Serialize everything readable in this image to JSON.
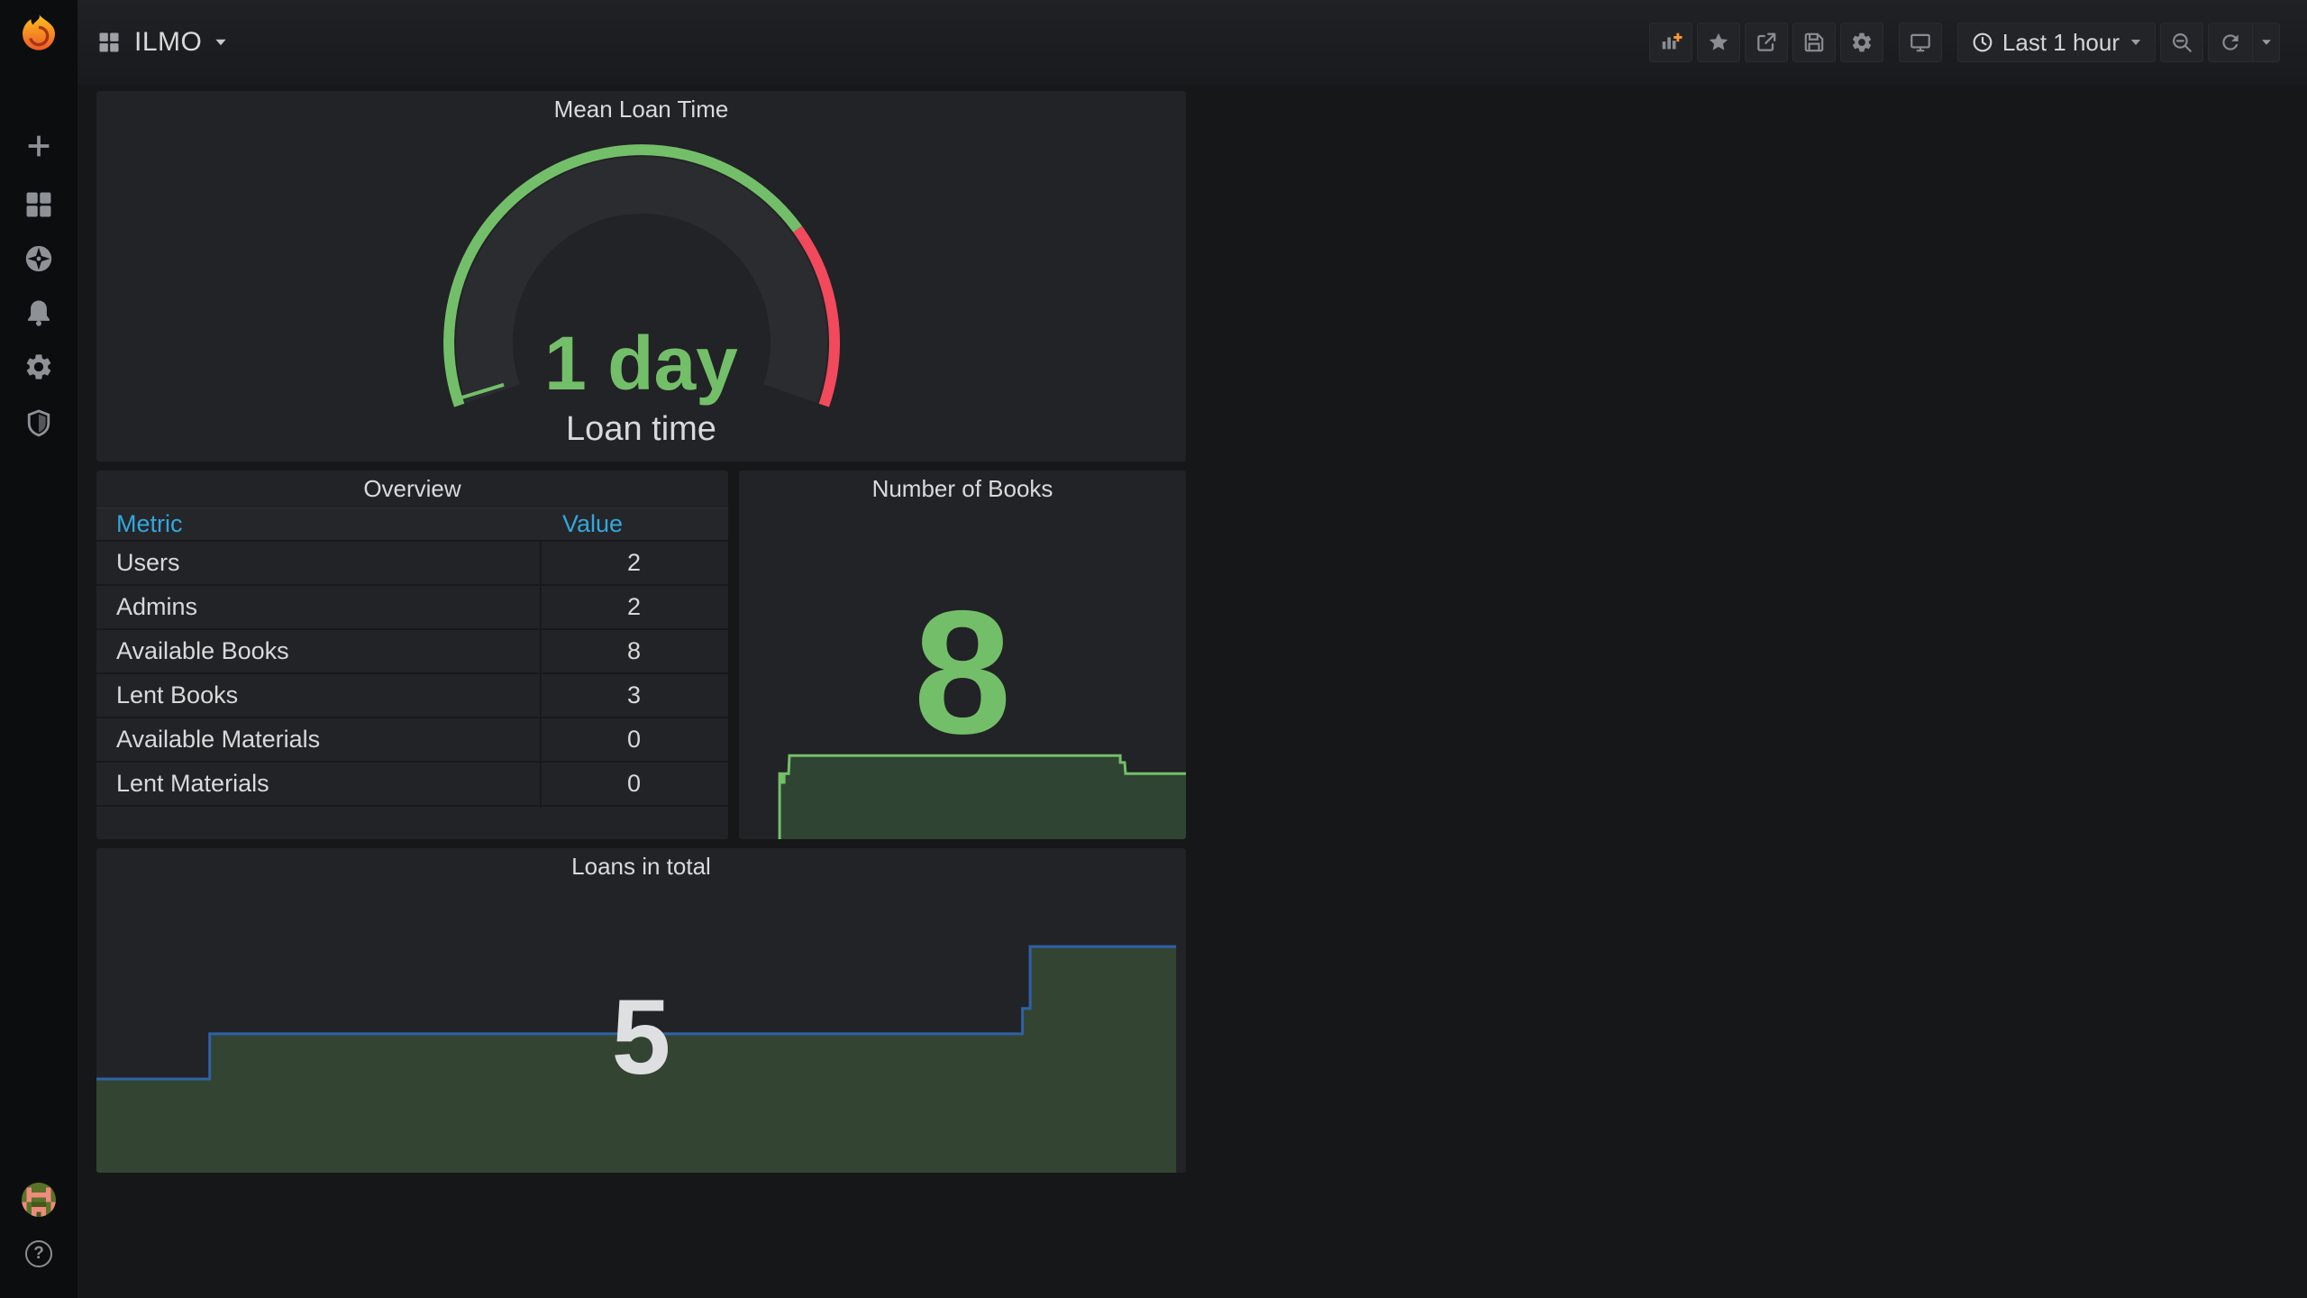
{
  "nav": {
    "dashboard_title": "ILMO",
    "time_range_label": "Last 1 hour",
    "actions": {
      "add_panel": "add-panel",
      "star": "mark-as-favorite",
      "share": "share-dashboard",
      "save": "save-dashboard",
      "settings": "dashboard-settings",
      "tv_mode": "cycle-view-mode",
      "zoom_out": "zoom-out-time-range",
      "refresh": "refresh-dashboard"
    }
  },
  "sidebar": {
    "items": [
      {
        "label": "Create",
        "icon": "plus-icon"
      },
      {
        "label": "Dashboards",
        "icon": "grid-icon"
      },
      {
        "label": "Explore",
        "icon": "compass-icon"
      },
      {
        "label": "Alerting",
        "icon": "bell-icon"
      },
      {
        "label": "Configuration",
        "icon": "gear-icon"
      },
      {
        "label": "Server Admin",
        "icon": "shield-icon"
      }
    ],
    "help_label": "?"
  },
  "panels": {
    "gauge": {
      "title": "Mean Loan Time",
      "value": "1 day",
      "label": "Loan time",
      "value_color": "#73bf69",
      "ring_green": "#73bf69",
      "ring_red": "#f2495c"
    },
    "overview": {
      "title": "Overview",
      "columns": [
        "Metric",
        "Value"
      ],
      "rows": [
        [
          "Users",
          "2"
        ],
        [
          "Admins",
          "2"
        ],
        [
          "Available Books",
          "8"
        ],
        [
          "Lent Books",
          "3"
        ],
        [
          "Available Materials",
          "0"
        ],
        [
          "Lent Materials",
          "0"
        ]
      ],
      "header_color": "#33a7dd"
    },
    "books": {
      "title": "Number of Books",
      "value": "8",
      "value_color": "#73bf69"
    },
    "loans": {
      "title": "Loans in total",
      "value": "5",
      "value_color": "#dedfe0"
    }
  },
  "chart_data": [
    {
      "id": "gauge",
      "type": "gauge",
      "title": "Mean Loan Time",
      "value_text": "1 day",
      "label": "Loan time",
      "arc_degrees": 218,
      "threshold_green_fraction": 0.75,
      "threshold_red_fraction": 0.25,
      "colors": {
        "green": "#73bf69",
        "red": "#f2495c",
        "body": "#2a2c30"
      }
    },
    {
      "id": "books",
      "type": "area",
      "title": "Number of Books",
      "current": 8,
      "values_approx": [
        8,
        9,
        8
      ],
      "line_color": "#73bf69",
      "fill_color": "#304433",
      "points_norm": [
        [
          0.091,
          0.0
        ],
        [
          0.091,
          0.178
        ],
        [
          0.095,
          0.178
        ],
        [
          0.097,
          0.154
        ],
        [
          0.101,
          0.154
        ],
        [
          0.101,
          0.178
        ],
        [
          0.111,
          0.178
        ],
        [
          0.113,
          0.227
        ],
        [
          0.853,
          0.227
        ],
        [
          0.853,
          0.208
        ],
        [
          0.863,
          0.208
        ],
        [
          0.865,
          0.178
        ],
        [
          1.0,
          0.178
        ]
      ]
    },
    {
      "id": "loans",
      "type": "area",
      "title": "Loans in total",
      "current": 5,
      "values_approx": [
        3,
        4,
        5
      ],
      "line_color": "#2e62a8",
      "fill_color": "#334532",
      "points_norm": [
        [
          0.0,
          0.289
        ],
        [
          0.104,
          0.289
        ],
        [
          0.104,
          0.428
        ],
        [
          0.85,
          0.428
        ],
        [
          0.85,
          0.506
        ],
        [
          0.857,
          0.506
        ],
        [
          0.857,
          0.697
        ],
        [
          0.991,
          0.697
        ]
      ]
    },
    {
      "id": "overview",
      "type": "table",
      "columns": [
        "Metric",
        "Value"
      ],
      "rows": [
        [
          "Users",
          2
        ],
        [
          "Admins",
          2
        ],
        [
          "Available Books",
          8
        ],
        [
          "Lent Books",
          3
        ],
        [
          "Available Materials",
          0
        ],
        [
          "Lent Materials",
          0
        ]
      ]
    }
  ]
}
